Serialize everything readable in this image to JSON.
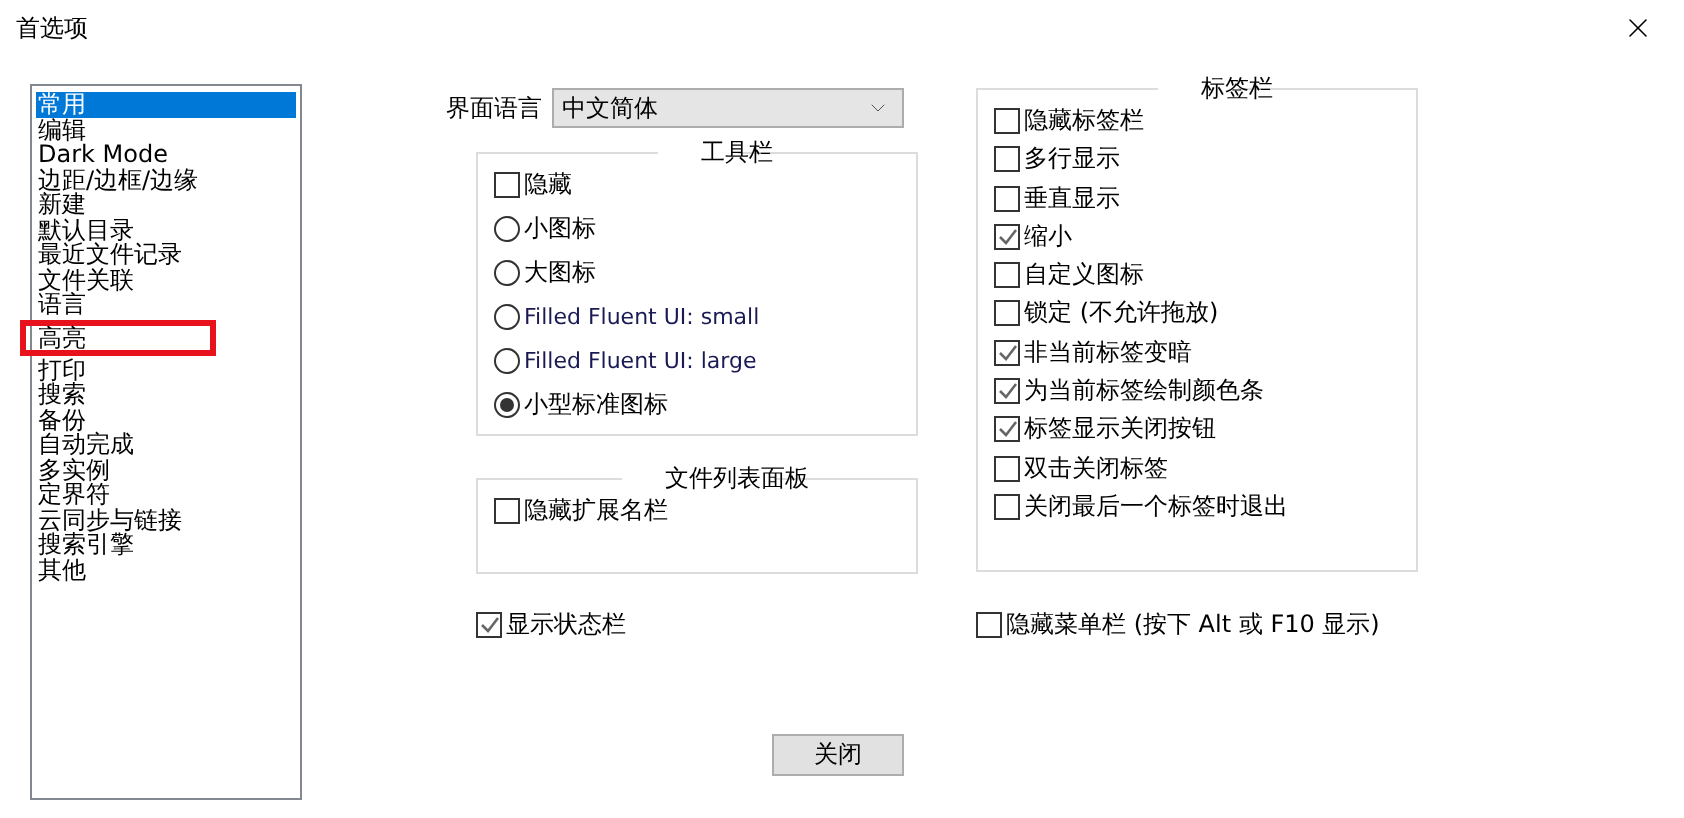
{
  "window": {
    "title": "首选项"
  },
  "categories": [
    {
      "label": "常用",
      "selected": true,
      "highlighted": false
    },
    {
      "label": "编辑",
      "selected": false,
      "highlighted": false
    },
    {
      "label": "Dark Mode",
      "selected": false,
      "highlighted": false
    },
    {
      "label": "边距/边框/边缘",
      "selected": false,
      "highlighted": false
    },
    {
      "label": "新建",
      "selected": false,
      "highlighted": false
    },
    {
      "label": "默认目录",
      "selected": false,
      "highlighted": false
    },
    {
      "label": "最近文件记录",
      "selected": false,
      "highlighted": false
    },
    {
      "label": "文件关联",
      "selected": false,
      "highlighted": false
    },
    {
      "label": "语言",
      "selected": false,
      "highlighted": false
    },
    {
      "label": "高亮",
      "selected": false,
      "highlighted": true
    },
    {
      "label": "打印",
      "selected": false,
      "highlighted": false
    },
    {
      "label": "搜索",
      "selected": false,
      "highlighted": false
    },
    {
      "label": "备份",
      "selected": false,
      "highlighted": false
    },
    {
      "label": "自动完成",
      "selected": false,
      "highlighted": false
    },
    {
      "label": "多实例",
      "selected": false,
      "highlighted": false
    },
    {
      "label": "定界符",
      "selected": false,
      "highlighted": false
    },
    {
      "label": "云同步与链接",
      "selected": false,
      "highlighted": false
    },
    {
      "label": "搜索引擎",
      "selected": false,
      "highlighted": false
    },
    {
      "label": "其他",
      "selected": false,
      "highlighted": false
    }
  ],
  "language": {
    "label": "界面语言",
    "value": "中文简体"
  },
  "toolbar": {
    "title": "工具栏",
    "options": [
      {
        "kind": "checkbox",
        "label": "隐藏",
        "checked": false
      },
      {
        "kind": "radio",
        "label": "小图标",
        "selected": false
      },
      {
        "kind": "radio",
        "label": "大图标",
        "selected": false
      },
      {
        "kind": "radio",
        "label": "Filled Fluent UI: small",
        "selected": false
      },
      {
        "kind": "radio",
        "label": "Filled Fluent UI: large",
        "selected": false
      },
      {
        "kind": "radio",
        "label": "小型标准图标",
        "selected": true
      }
    ]
  },
  "file_list_panel": {
    "title": "文件列表面板",
    "options": [
      {
        "label": "隐藏扩展名栏",
        "checked": false
      }
    ]
  },
  "tab_bar": {
    "title": "标签栏",
    "options": [
      {
        "label": "隐藏标签栏",
        "checked": false
      },
      {
        "label": "多行显示",
        "checked": false
      },
      {
        "label": "垂直显示",
        "checked": false
      },
      {
        "label": "缩小",
        "checked": true
      },
      {
        "label": "自定义图标",
        "checked": false
      },
      {
        "label": "锁定 (不允许拖放)",
        "checked": false
      },
      {
        "label": "非当前标签变暗",
        "checked": true
      },
      {
        "label": "为当前标签绘制颜色条",
        "checked": true
      },
      {
        "label": "标签显示关闭按钮",
        "checked": true
      },
      {
        "label": "双击关闭标签",
        "checked": false
      },
      {
        "label": "关闭最后一个标签时退出",
        "checked": false
      }
    ]
  },
  "show_status_bar": {
    "label": "显示状态栏",
    "checked": true
  },
  "hide_menu_bar": {
    "label": "隐藏菜单栏 (按下 Alt 或 F10 显示)",
    "checked": false
  },
  "buttons": [
    {
      "label": "关闭"
    }
  ]
}
